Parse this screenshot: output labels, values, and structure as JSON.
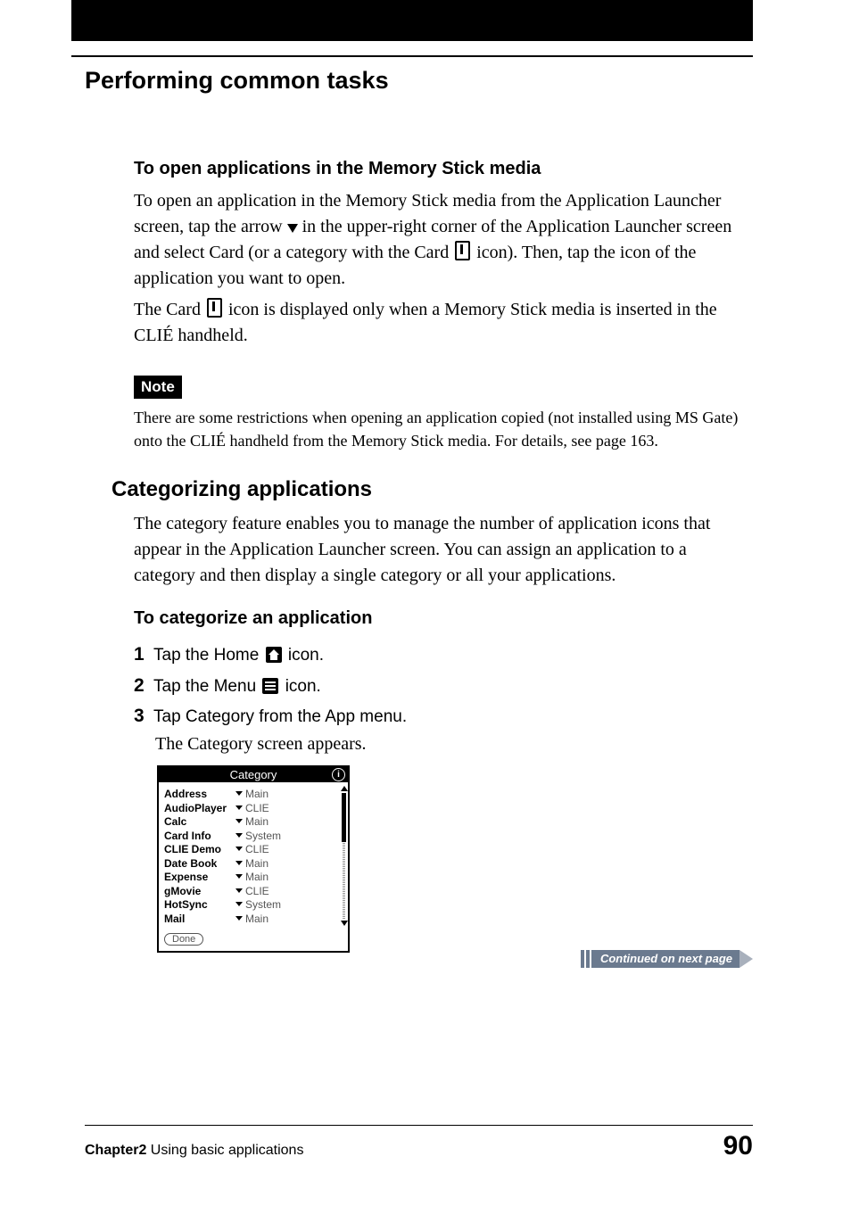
{
  "page_title": "Performing common tasks",
  "section1": {
    "heading": "To open applications in the Memory Stick media",
    "p1a": "To open an application in the Memory Stick media from the Application Launcher screen, tap the arrow ",
    "p1b": " in the upper-right corner of the Application Launcher screen and select Card (or a category with the Card ",
    "p1c": " icon). Then, tap the icon of the application you want to open.",
    "p2a": "The Card ",
    "p2b": " icon is displayed only when a Memory Stick media is inserted in the CLIÉ handheld."
  },
  "note_label": "Note",
  "note_text": "There are some restrictions when opening an application copied (not installed using MS Gate) onto the CLIÉ handheld from the Memory Stick media. For details, see page 163.",
  "section2": {
    "heading": "Categorizing applications",
    "p1": "The category feature enables you to manage the number of application icons that appear in the Application Launcher screen. You can assign an application to a category and then display a single category or all your applications."
  },
  "section3": {
    "heading": "To categorize an application",
    "steps": [
      {
        "num": "1",
        "pre": "Tap the Home ",
        "post": " icon."
      },
      {
        "num": "2",
        "pre": "Tap the Menu ",
        "post": " icon."
      },
      {
        "num": "3",
        "text": "Tap Category from the App menu."
      }
    ],
    "follow": "The Category screen appears."
  },
  "screenshot": {
    "title": "Category",
    "rows": [
      {
        "name": "Address",
        "cat": "Main"
      },
      {
        "name": "AudioPlayer",
        "cat": "CLIE"
      },
      {
        "name": "Calc",
        "cat": "Main"
      },
      {
        "name": "Card Info",
        "cat": "System"
      },
      {
        "name": "CLIE Demo",
        "cat": "CLIE"
      },
      {
        "name": "Date Book",
        "cat": "Main"
      },
      {
        "name": "Expense",
        "cat": "Main"
      },
      {
        "name": "gMovie",
        "cat": "CLIE"
      },
      {
        "name": "HotSync",
        "cat": "System"
      },
      {
        "name": "Mail",
        "cat": "Main"
      }
    ],
    "done": "Done"
  },
  "continued": "Continued on next page",
  "footer": {
    "chapter_bold": "Chapter2",
    "chapter_rest": "  Using basic applications",
    "page": "90"
  }
}
